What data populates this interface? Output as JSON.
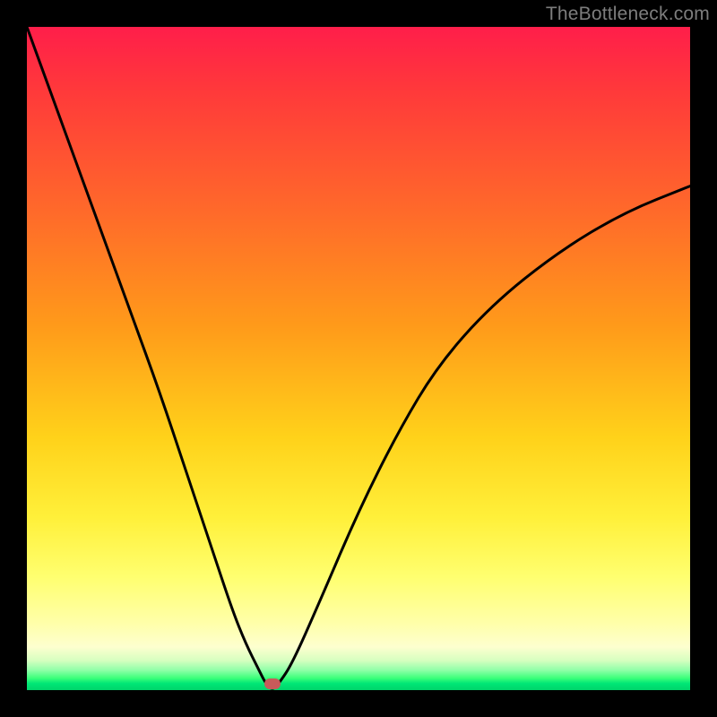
{
  "watermark": {
    "text": "TheBottleneck.com"
  },
  "colors": {
    "page_bg": "#000000",
    "curve": "#000000",
    "marker": "#c85a5a",
    "gradient_stops": [
      "#ff1e4a",
      "#ff3a3a",
      "#ff6a2a",
      "#ff9a1a",
      "#ffd21a",
      "#fff03a",
      "#ffff70",
      "#ffffaa",
      "#fdffcf",
      "#d7ffc0",
      "#8fffa8",
      "#3bff7a",
      "#00e676",
      "#00d46a"
    ]
  },
  "chart_data": {
    "type": "line",
    "title": "",
    "xlabel": "",
    "ylabel": "",
    "xlim": [
      0,
      100
    ],
    "ylim": [
      0,
      100
    ],
    "note": "V-shaped bottleneck curve; horizontal axis is relative component strength, vertical axis is bottleneck percentage. Minimum (≈0%) occurs at x≈37.",
    "x": [
      0,
      4,
      8,
      12,
      16,
      20,
      24,
      28,
      31,
      33,
      35,
      36,
      37,
      38,
      40,
      44,
      50,
      56,
      62,
      70,
      80,
      90,
      100
    ],
    "y": [
      100,
      89,
      78,
      67,
      56,
      45,
      33,
      21,
      12,
      7,
      3,
      1,
      0,
      1,
      4,
      13,
      27,
      39,
      49,
      58,
      66,
      72,
      76
    ],
    "marker": {
      "x": 37,
      "y": 0
    }
  }
}
